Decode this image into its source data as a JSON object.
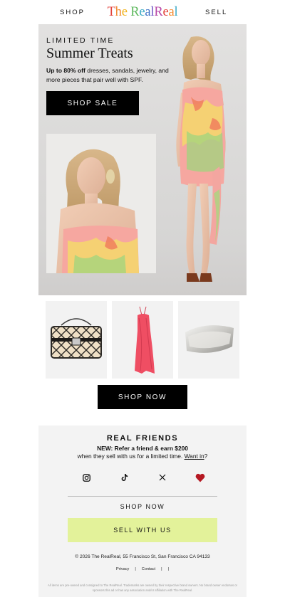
{
  "header": {
    "nav_left": "SHOP",
    "nav_right": "SELL",
    "logo_text": "The RealReal",
    "logo_letter_colors": [
      "#e3423b",
      "#f28a2e",
      "#f1b41b",
      "#5cb85c",
      "#39a9c4",
      "#3f73c7",
      "#6f52c4",
      "#b94aa9",
      "#e3423b",
      "#f28a2e",
      "#39a9c4",
      "#6f52c4"
    ]
  },
  "hero": {
    "kicker": "LIMITED TIME",
    "headline": "Summer Treats",
    "subcopy_bold": "Up to 80% off",
    "subcopy_rest": " dresses, sandals, jewelry, and more pieces that pair well with SPF.",
    "cta": "SHOP SALE"
  },
  "products": {
    "items": [
      {
        "icon": "quilted-handbag-icon"
      },
      {
        "icon": "pink-gown-icon"
      },
      {
        "icon": "silver-cuff-icon"
      }
    ],
    "cta": "SHOP NOW"
  },
  "footer": {
    "title": "REAL FRIENDS",
    "line1": "NEW: Refer a friend & earn $200",
    "line2": "when they sell with us for a limited time. ",
    "line2_link": "Want in",
    "line2_end": "?",
    "social": [
      "instagram-icon",
      "tiktok-icon",
      "x-icon",
      "heart-icon"
    ],
    "shop_now": "SHOP NOW",
    "sell_cta": "SELL WITH US",
    "address": "© 2026 The RealReal, 55 Francisco St, San Francisco CA 94133",
    "links": [
      "Privacy",
      "|",
      "Contact",
      "|",
      "|"
    ],
    "disclaimer": "All items are pre-owned and consigned to The RealReal. Trademarks are owned by their respective brand owners. No brand owner endorses or sponsors this ad or has any association and/or affiliation with The RealReal."
  },
  "colors": {
    "accent_sell": "#e3f29a",
    "button_black": "#000000",
    "heart": "#b51822"
  }
}
